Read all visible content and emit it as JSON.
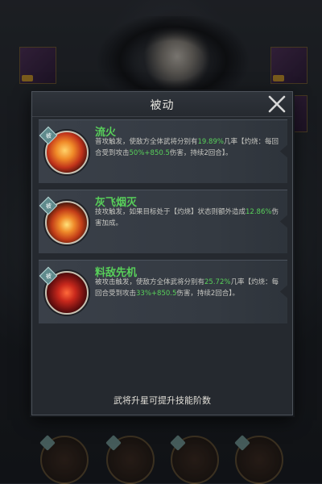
{
  "dialog": {
    "title": "被动",
    "footer_note": "武将升星可提升技能阶数"
  },
  "skills": [
    {
      "name": "流火",
      "desc_a": "普攻触发，使敌方全体武将分别有",
      "val1": "19.89%",
      "desc_b": "几率【灼烧：每回合受到攻击",
      "val2": "50%+850.5",
      "desc_c": "伤害，持续2回合】。",
      "icon": "fire-fox-icon"
    },
    {
      "name": "灰飞烟灭",
      "desc_a": "技攻触发，如果目标处于【灼烧】状态则额外造成",
      "val1": "12.86%",
      "desc_b": "伤害加成。",
      "icon": "flame-spirit-icon"
    },
    {
      "name": "料敌先机",
      "desc_a": "被攻击触发，使敌方全体武将分别有",
      "val1": "25.72%",
      "desc_b": "几率【灼烧：每回合受到攻击",
      "val2": "33%+850.5",
      "desc_c": "伤害，持续2回合】。",
      "icon": "demon-mask-icon"
    }
  ],
  "badge_label": "被",
  "colors": {
    "accent_green": "#58d05a",
    "dialog_bg": "#25292f"
  }
}
